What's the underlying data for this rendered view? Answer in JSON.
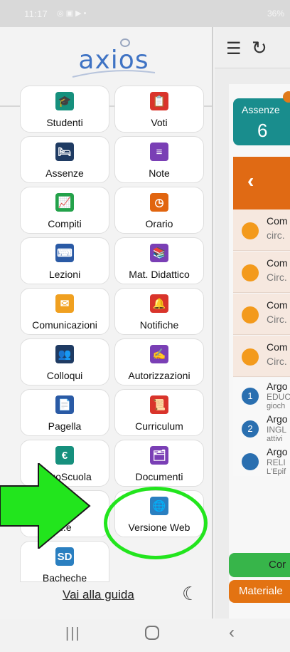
{
  "status_bar": {
    "time": "11:17",
    "battery": "36%"
  },
  "drawer": {
    "logo_text": "axios",
    "tiles": [
      {
        "label": "Studenti",
        "icon": "graduation-cap-icon",
        "color": "#16907d",
        "glyph": "🎓"
      },
      {
        "label": "Voti",
        "icon": "grades-clipboard-icon",
        "color": "#d9342b",
        "glyph": "📋"
      },
      {
        "label": "Assenze",
        "icon": "bed-icon",
        "color": "#1f3b63",
        "glyph": "🛏"
      },
      {
        "label": "Note",
        "icon": "note-icon",
        "color": "#7a3fb5",
        "glyph": "≡"
      },
      {
        "label": "Compiti",
        "icon": "chart-board-icon",
        "color": "#23a24a",
        "glyph": "📈"
      },
      {
        "label": "Orario",
        "icon": "clock-icon",
        "color": "#e1650f",
        "glyph": "◷"
      },
      {
        "label": "Lezioni",
        "icon": "teacher-board-icon",
        "color": "#2a5aa5",
        "glyph": "⌨"
      },
      {
        "label": "Mat. Didattico",
        "icon": "books-icon",
        "color": "#7a3fb5",
        "glyph": "📚"
      },
      {
        "label": "Comunicazioni",
        "icon": "pdf-file-icon",
        "color": "#f0a020",
        "glyph": "✉"
      },
      {
        "label": "Notifiche",
        "icon": "bell-icon",
        "color": "#d9342b",
        "glyph": "🔔"
      },
      {
        "label": "Colloqui",
        "icon": "people-icon",
        "color": "#1f3b63",
        "glyph": "👥"
      },
      {
        "label": "Autorizzazioni",
        "icon": "signature-icon",
        "color": "#7a3fb5",
        "glyph": "✍"
      },
      {
        "label": "Pagella",
        "icon": "report-card-icon",
        "color": "#2a5aa5",
        "glyph": "📄"
      },
      {
        "label": "Curriculum",
        "icon": "certificate-icon",
        "color": "#d9342b",
        "glyph": "📜"
      },
      {
        "label": "PagoScuola",
        "icon": "euro-icon",
        "color": "#16907d",
        "glyph": "€"
      },
      {
        "label": "Documenti",
        "icon": "documents-icon",
        "color": "#7a3fb5",
        "glyph": "🗂"
      },
      {
        "label": "...e",
        "icon": "user-card-icon",
        "color": "#1f3b63",
        "glyph": "👤"
      },
      {
        "label": "Versione Web",
        "icon": "globe-icon",
        "color": "#2a7fc0",
        "glyph": "🌐"
      },
      {
        "label": "Bacheche",
        "icon": "sd-board-icon",
        "color": "#2a7fc0",
        "glyph": "SD"
      }
    ],
    "guide_link": "Vai alla guida"
  },
  "content": {
    "badge_label": "Assenze",
    "badge_value": "6",
    "rows": [
      {
        "title": "Com",
        "sub": "circ."
      },
      {
        "title": "Com",
        "sub": "Circ."
      },
      {
        "title": "Com",
        "sub": "Circ."
      },
      {
        "title": "Com",
        "sub": "Circ."
      }
    ],
    "arg_rows": [
      {
        "num": "1",
        "title": "Argo",
        "sub": "EDUC",
        "extra": "gioch"
      },
      {
        "num": "2",
        "title": "Argo",
        "sub": "INGL",
        "extra": "attivi"
      },
      {
        "num": "",
        "title": "Argo",
        "sub": "RELI",
        "extra": "L'Epif"
      }
    ],
    "green_button": "Cor",
    "orange_button": "Materiale"
  }
}
